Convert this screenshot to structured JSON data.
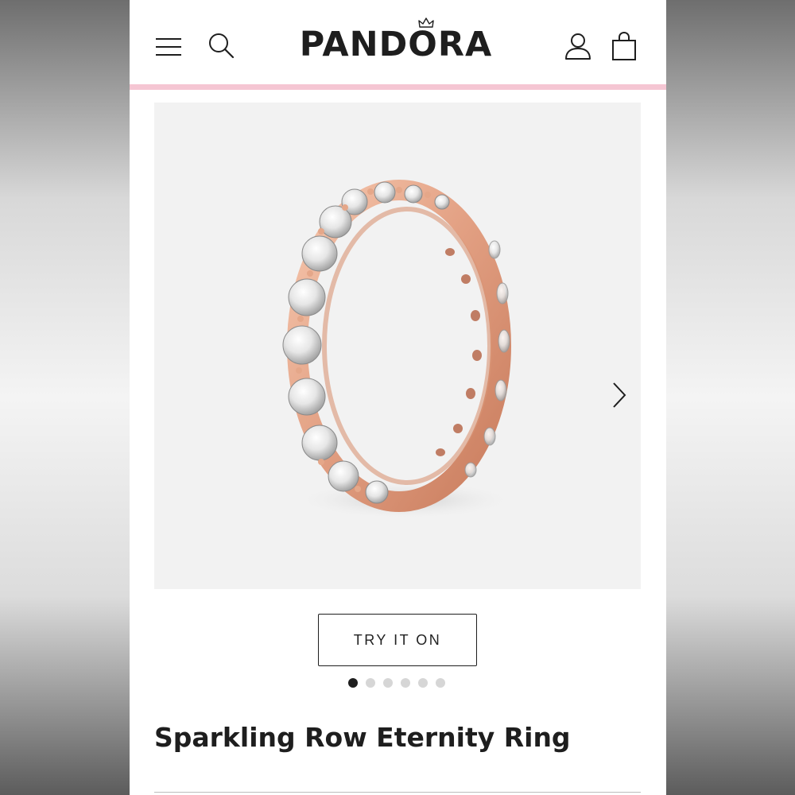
{
  "header": {
    "logo_text": "PANDORA",
    "menu_icon": "hamburger-menu-icon",
    "search_icon": "search-icon",
    "account_icon": "user-account-icon",
    "bag_icon": "shopping-bag-icon",
    "accent_line_color": "#f5c6d3"
  },
  "gallery": {
    "image_alt": "Rose gold eternity ring with clear stones",
    "next_icon": "chevron-right-icon",
    "try_on_label": "TRY IT ON",
    "slide_count": 6,
    "active_slide": 1
  },
  "product": {
    "name": "Sparkling Row Eternity Ring"
  },
  "colors": {
    "text": "#1e1e1e",
    "image_background": "#f2f2f2",
    "metal": "#e8a98a"
  }
}
